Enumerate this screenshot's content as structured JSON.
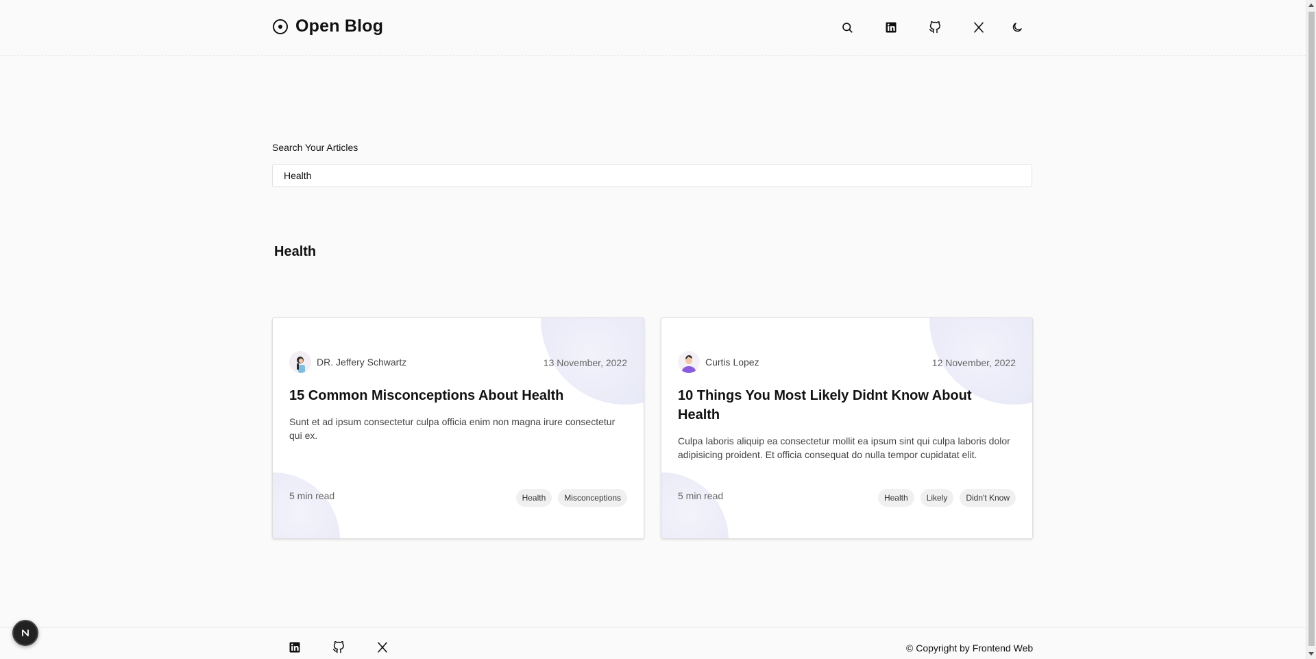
{
  "header": {
    "brand": "Open Blog",
    "icons": [
      "search-icon",
      "linkedin-icon",
      "github-icon",
      "x-icon",
      "moon-icon"
    ]
  },
  "search": {
    "label": "Search Your Articles",
    "value": "Health"
  },
  "section": {
    "title": "Health"
  },
  "cards": [
    {
      "author": "DR. Jeffery Schwartz",
      "date": "13 November, 2022",
      "title": "15 Common Misconceptions About Health",
      "description": "Sunt et ad ipsum consectetur culpa officia enim non magna irure consectetur qui ex.",
      "read_time": "5 min read",
      "tags": [
        "Health",
        "Misconceptions"
      ]
    },
    {
      "author": "Curtis Lopez",
      "date": "12 November, 2022",
      "title": "10 Things You Most Likely Didnt Know About Health",
      "description": "Culpa laboris aliquip ea consectetur mollit ea ipsum sint qui culpa laboris dolor adipisicing proident. Et officia consequat do nulla tempor cupidatat elit.",
      "read_time": "5 min read",
      "tags": [
        "Health",
        "Likely",
        "Didn't Know"
      ]
    }
  ],
  "footer": {
    "icons": [
      "linkedin-icon",
      "github-icon",
      "x-icon"
    ],
    "copyright": "© Copyright by Frontend Web"
  },
  "badge": {
    "letter": "N"
  },
  "colors": {
    "background": "#fafafa",
    "card_blob": "#e4e5f6",
    "tag_bg": "#f0f0f0"
  }
}
